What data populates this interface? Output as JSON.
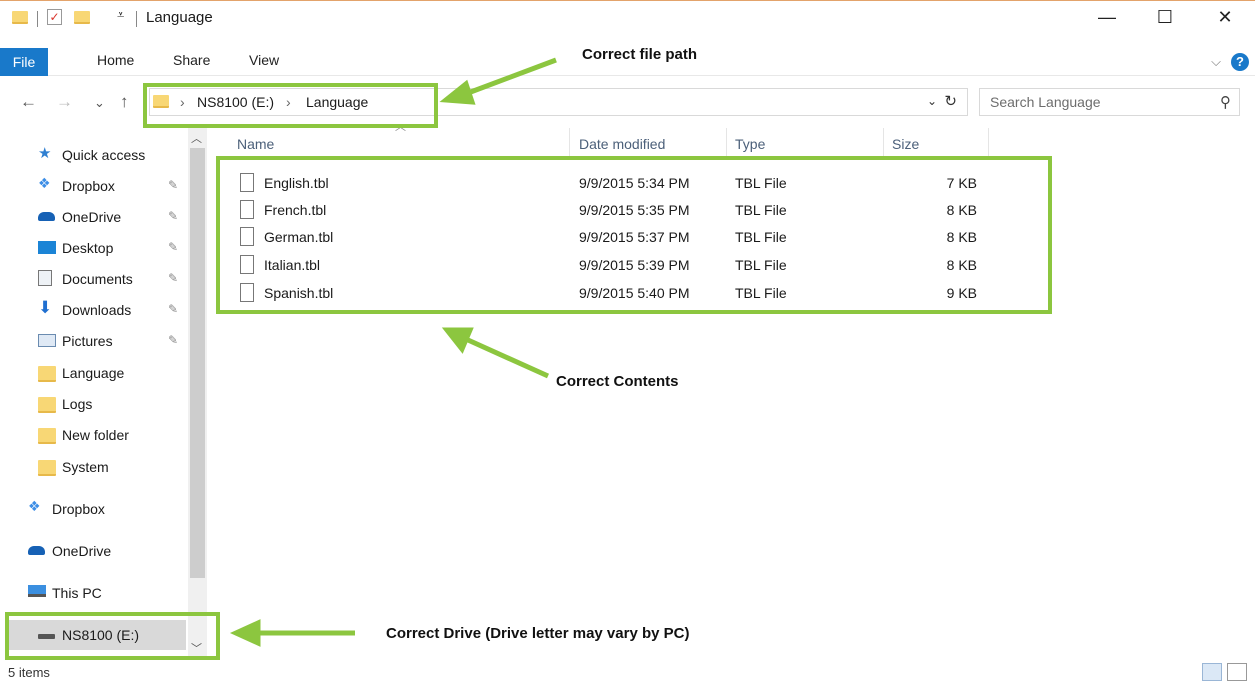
{
  "window": {
    "title": "Language",
    "minimize": "—",
    "maximize": "☐",
    "close": "✕"
  },
  "ribbon": {
    "tabs": [
      "File",
      "Home",
      "Share",
      "View"
    ],
    "help": "?",
    "collapse": "⌵"
  },
  "nav_buttons": {
    "back": "←",
    "forward": "→",
    "recent": "⌄",
    "up": "↑"
  },
  "address": {
    "crumbs": [
      "NS8100 (E:)",
      "Language"
    ],
    "separator": "›",
    "dropdown": "⌄",
    "refresh": "↻"
  },
  "search": {
    "placeholder": "Search Language",
    "icon": "search-icon"
  },
  "navpane": {
    "items": [
      {
        "label": "Quick access",
        "icon": "star-icon",
        "pinned": false
      },
      {
        "label": "Dropbox",
        "icon": "dropbox-icon",
        "pinned": true
      },
      {
        "label": "OneDrive",
        "icon": "onedrive-icon",
        "pinned": true
      },
      {
        "label": "Desktop",
        "icon": "desktop-icon",
        "pinned": true
      },
      {
        "label": "Documents",
        "icon": "documents-icon",
        "pinned": true
      },
      {
        "label": "Downloads",
        "icon": "downloads-icon",
        "pinned": true
      },
      {
        "label": "Pictures",
        "icon": "pictures-icon",
        "pinned": true
      },
      {
        "label": "Language",
        "icon": "folder-icon",
        "pinned": false
      },
      {
        "label": "Logs",
        "icon": "folder-icon",
        "pinned": false
      },
      {
        "label": "New folder",
        "icon": "folder-icon",
        "pinned": false
      },
      {
        "label": "System",
        "icon": "folder-icon",
        "pinned": false
      },
      {
        "label": "Dropbox",
        "icon": "dropbox-icon",
        "pinned": false
      },
      {
        "label": "OneDrive",
        "icon": "onedrive-icon",
        "pinned": false
      },
      {
        "label": "This PC",
        "icon": "this-pc-icon",
        "pinned": false
      },
      {
        "label": "NS8100 (E:)",
        "icon": "drive-icon",
        "pinned": false,
        "selected": true
      }
    ]
  },
  "columns": [
    "Name",
    "Date modified",
    "Type",
    "Size"
  ],
  "files": [
    {
      "name": "English.tbl",
      "date": "9/9/2015 5:34 PM",
      "type": "TBL File",
      "size": "7 KB"
    },
    {
      "name": "French.tbl",
      "date": "9/9/2015 5:35 PM",
      "type": "TBL File",
      "size": "8 KB"
    },
    {
      "name": "German.tbl",
      "date": "9/9/2015 5:37 PM",
      "type": "TBL File",
      "size": "8 KB"
    },
    {
      "name": "Italian.tbl",
      "date": "9/9/2015 5:39 PM",
      "type": "TBL File",
      "size": "8 KB"
    },
    {
      "name": "Spanish.tbl",
      "date": "9/9/2015 5:40 PM",
      "type": "TBL File",
      "size": "9 KB"
    }
  ],
  "annotations": {
    "path": "Correct file path",
    "contents": "Correct Contents",
    "drive": "Correct Drive (Drive letter may vary by PC)",
    "color": "#8cc63f"
  },
  "status": {
    "items": "5 items"
  },
  "colors": {
    "accent": "#1979ca",
    "folder": "#f8d775",
    "annotation": "#8cc63f"
  }
}
